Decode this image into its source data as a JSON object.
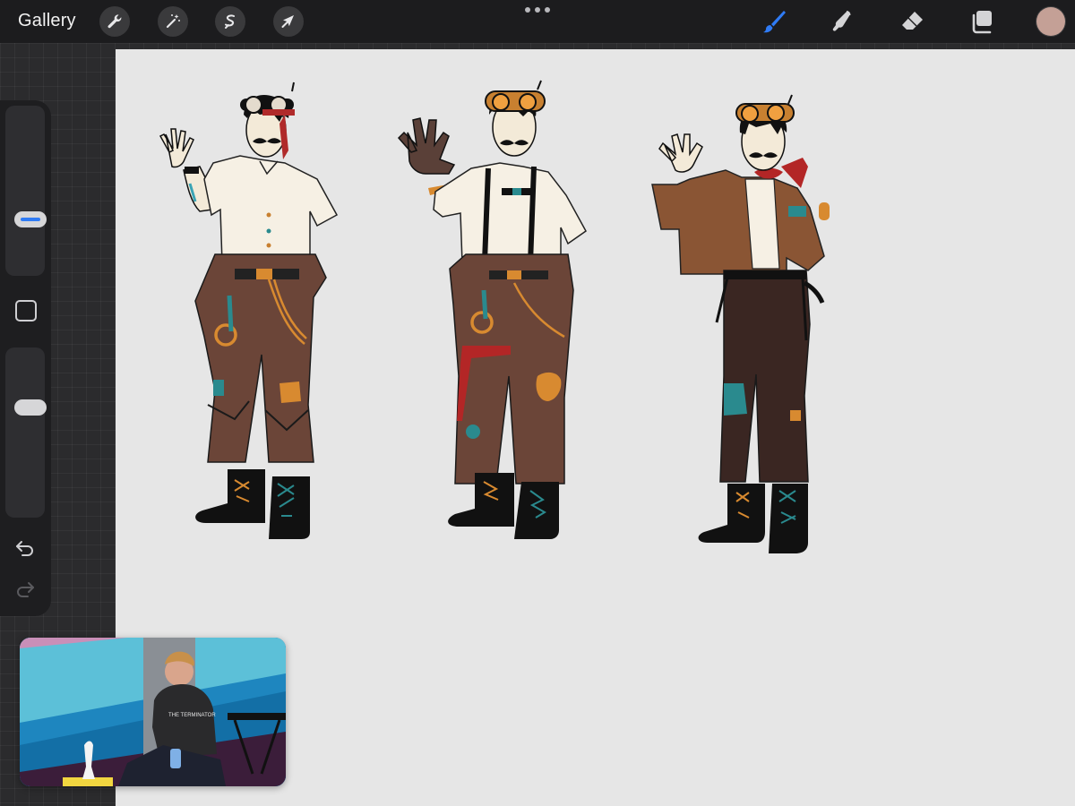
{
  "toolbar": {
    "gallery_label": "Gallery",
    "left_tools": [
      "wrench-icon",
      "magic-wand-icon",
      "selection-icon",
      "transform-arrow-icon"
    ],
    "right_tools": [
      "brush-icon",
      "smudge-icon",
      "eraser-icon",
      "layers-icon"
    ],
    "active_tool": "brush-icon",
    "active_color": "#c4a096",
    "accent_color": "#2f7bf5"
  },
  "sidebar": {
    "brush_size_slider": "brush-size",
    "opacity_slider": "brush-opacity",
    "undo_icon": "undo-icon",
    "redo_icon": "redo-icon"
  },
  "canvas": {
    "background_color": "#e6e6e6",
    "figures": [
      "character-1",
      "character-2",
      "character-3"
    ]
  },
  "video_overlay": {
    "shirt_text": "THE TERMINATOR"
  }
}
